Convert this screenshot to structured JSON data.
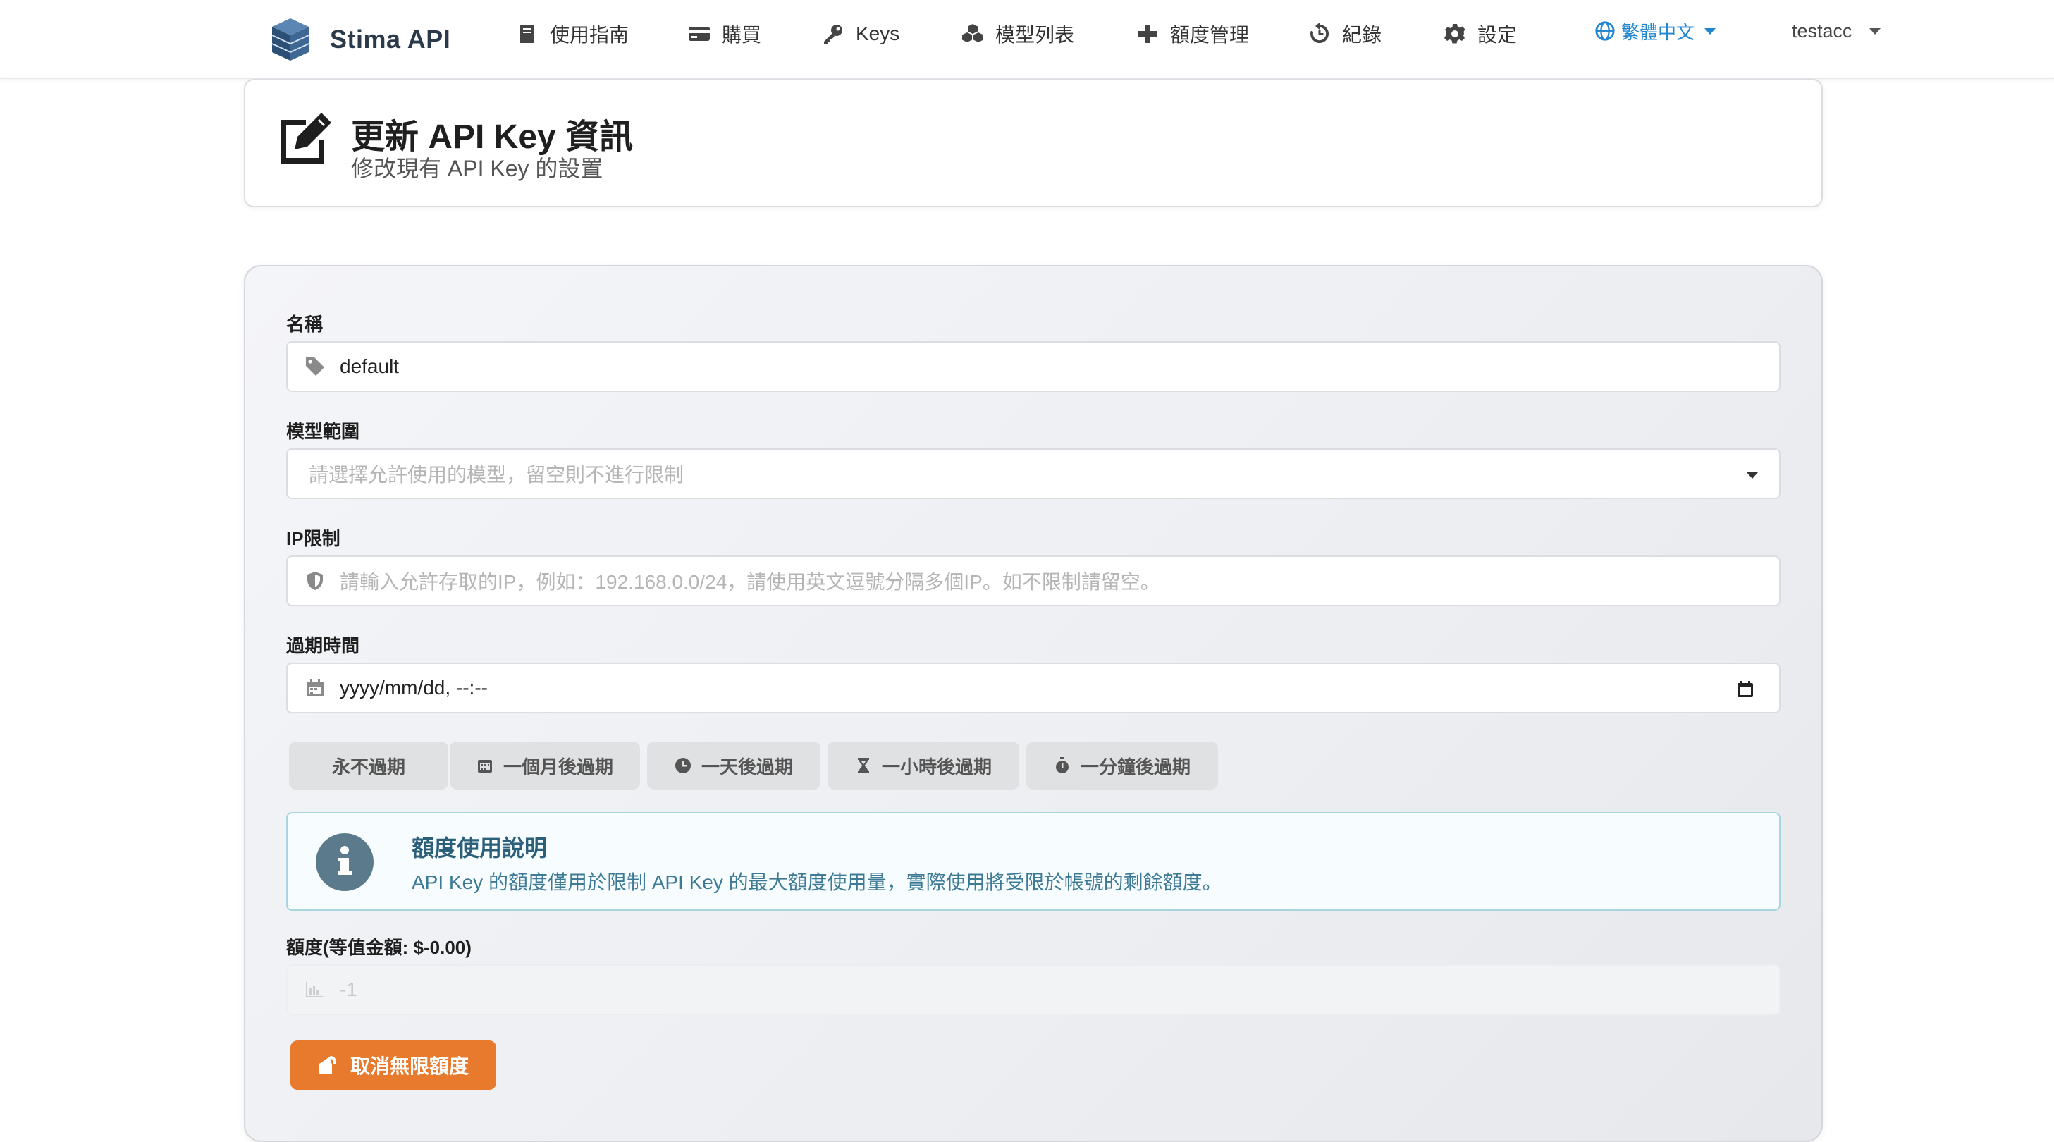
{
  "nav": {
    "brand": "Stima API",
    "items": [
      {
        "label": "使用指南",
        "icon": "book-icon"
      },
      {
        "label": "購買",
        "icon": "credit-card-icon"
      },
      {
        "label": "Keys",
        "icon": "key-icon"
      },
      {
        "label": "模型列表",
        "icon": "cubes-icon"
      },
      {
        "label": "額度管理",
        "icon": "plus-icon"
      },
      {
        "label": "紀錄",
        "icon": "history-icon"
      },
      {
        "label": "設定",
        "icon": "gear-icon"
      }
    ],
    "language": "繁體中文",
    "user": "testacc"
  },
  "header": {
    "title": "更新 API Key 資訊",
    "subtitle": "修改現有 API Key 的設置"
  },
  "form": {
    "name": {
      "label": "名稱",
      "value": "default"
    },
    "models": {
      "label": "模型範圍",
      "placeholder": "請選擇允許使用的模型，留空則不進行限制"
    },
    "ip": {
      "label": "IP限制",
      "placeholder": "請輸入允許存取的IP，例如：192.168.0.0/24，請使用英文逗號分隔多個IP。如不限制請留空。"
    },
    "expiry": {
      "label": "過期時間",
      "value": "yyyy/mm/dd, --:--"
    },
    "quick_buttons": [
      {
        "label": "永不過期"
      },
      {
        "label": "一個月後過期",
        "icon": "calendar-icon"
      },
      {
        "label": "一天後過期",
        "icon": "clock-icon"
      },
      {
        "label": "一小時後過期",
        "icon": "hourglass-icon"
      },
      {
        "label": "一分鐘後過期",
        "icon": "stopwatch-icon"
      }
    ],
    "info": {
      "title": "額度使用說明",
      "text": "API Key 的額度僅用於限制 API Key 的最大額度使用量，實際使用將受限於帳號的剩餘額度。"
    },
    "quota": {
      "label": "額度(等值金額: $-0.00)",
      "placeholder": "-1"
    },
    "unlimited_button": "取消無限額度"
  },
  "colors": {
    "accent_orange": "#e87a2e",
    "link_blue": "#2185d0",
    "info_border": "#a9d5de"
  }
}
